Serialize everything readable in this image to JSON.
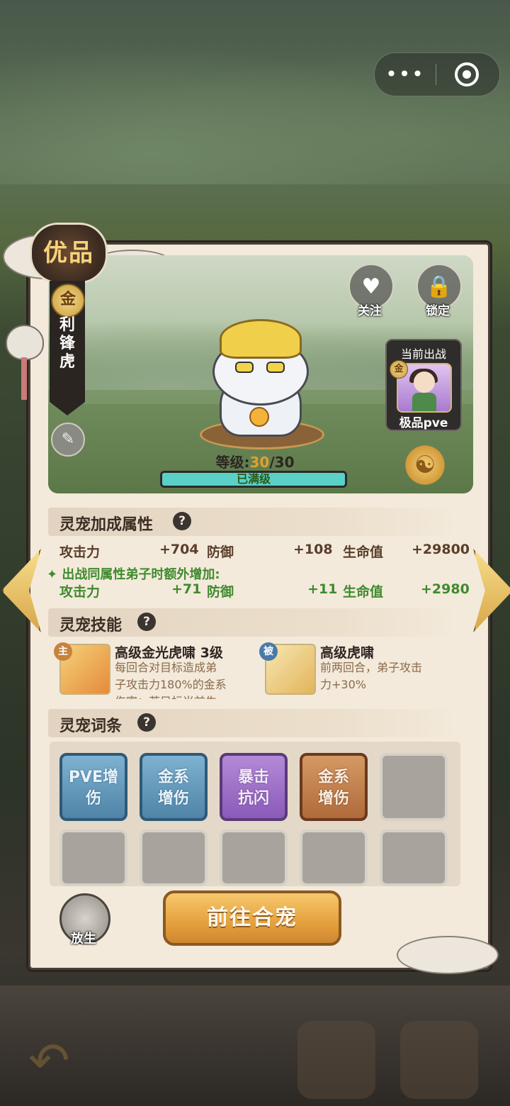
{
  "top_capsule": {
    "more_icon": "more-dots-icon",
    "close_icon": "target-circle-icon"
  },
  "quality_badge": "优品",
  "pet": {
    "element_coin": "金",
    "name": "利锋虎",
    "level_label": "等级:",
    "level_current": "30",
    "level_max": "/30",
    "level_progress": 1.0,
    "level_status": "已满级"
  },
  "actions": {
    "follow_label": "关注",
    "lock_label": "锁定"
  },
  "current_battle": {
    "title": "当前出战",
    "coin": "金",
    "name": "极品pve"
  },
  "bonus_section": {
    "title": "灵宠加成属性",
    "help": "?",
    "stats": [
      {
        "label": "攻击力",
        "value": "+704"
      },
      {
        "label": "防御",
        "value": "+108"
      },
      {
        "label": "生命值",
        "value": "+29800"
      }
    ],
    "extra_title": "出战同属性弟子时额外增加:",
    "extra_stats": [
      {
        "label": "攻击力",
        "value": "+71"
      },
      {
        "label": "防御",
        "value": "+11"
      },
      {
        "label": "生命值",
        "value": "+2980"
      }
    ]
  },
  "skills_section": {
    "title": "灵宠技能",
    "help": "?",
    "skills": [
      {
        "tag": "主",
        "name": "高级金光虎啸 3级",
        "desc_line1": "每回合对目标造成弟",
        "desc_line2": "子攻击力180%的金系",
        "desc_line3": "伤害；若目标当前生"
      },
      {
        "tag": "被",
        "name": "高级虎啸",
        "desc_line1": "前两回合，弟子攻击",
        "desc_line2": "力+30%"
      }
    ]
  },
  "affix_section": {
    "title": "灵宠词条",
    "help": "?",
    "tiles": [
      {
        "line1": "PVE增",
        "line2": "伤"
      },
      {
        "line1": "金系",
        "line2": "增伤"
      },
      {
        "line1": "暴击",
        "line2": "抗闪"
      },
      {
        "line1": "金系",
        "line2": "增伤"
      }
    ]
  },
  "bottom": {
    "main_button": "前往合宠",
    "release_label": "放生"
  },
  "colors": {
    "gold": "#e0a030",
    "green": "#3f8a2e",
    "teal": "#5ad0c6"
  }
}
